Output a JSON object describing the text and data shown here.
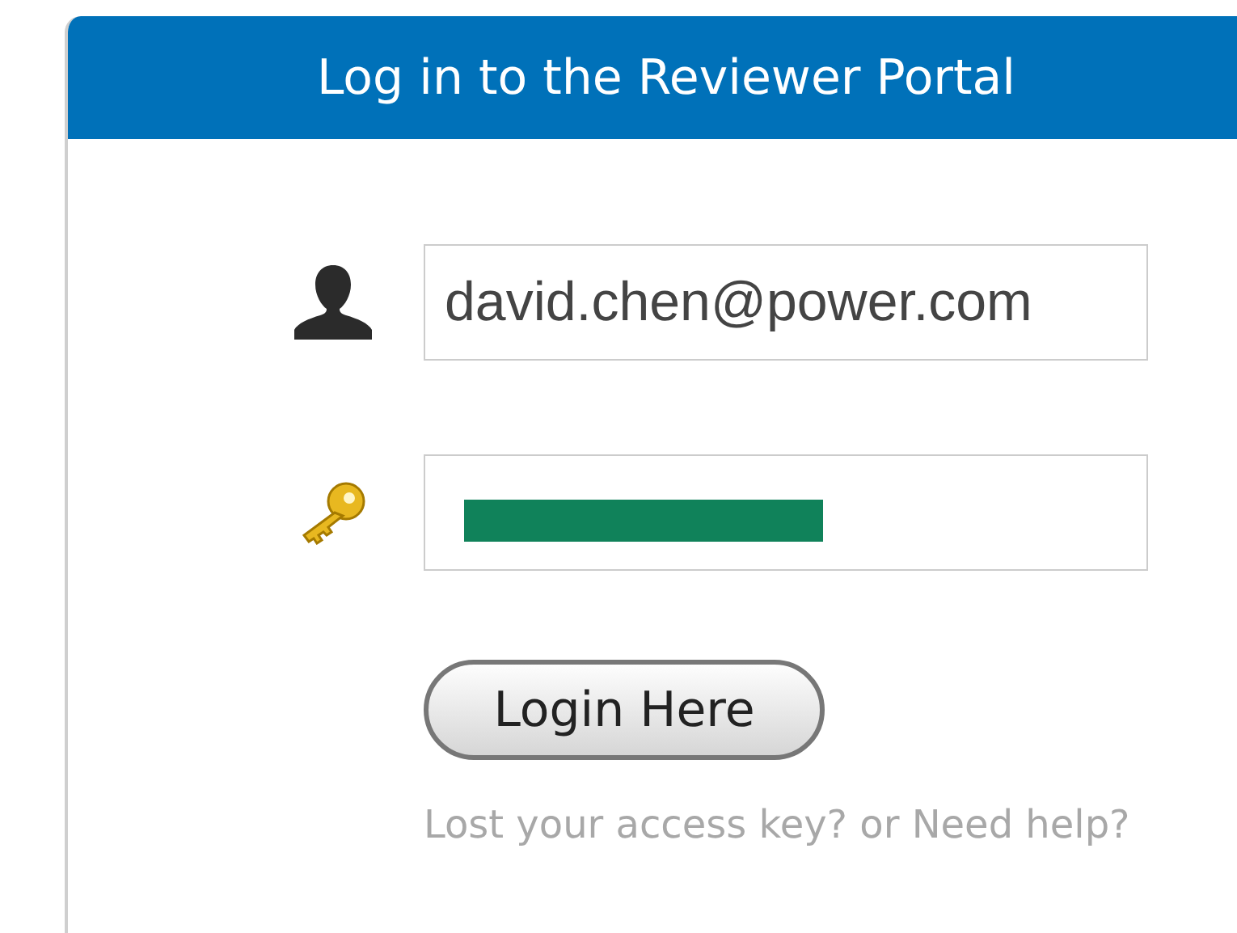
{
  "header": {
    "title": "Log in to the Reviewer Portal"
  },
  "username": {
    "value": "david.chen@power.com"
  },
  "password": {
    "redacted": true
  },
  "login_button": {
    "label": "Login Here"
  },
  "help_link": {
    "text": "Lost your access key? or Need help?"
  }
}
